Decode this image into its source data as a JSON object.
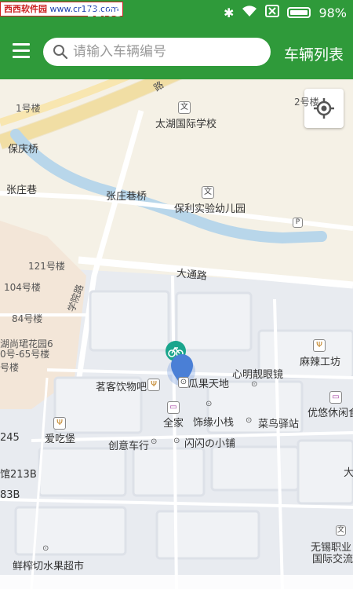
{
  "statusbar": {
    "watermark_a": "西西软件园",
    "watermark_b": "www.cr173.com",
    "time": "11:03",
    "battery_pct": "98%"
  },
  "appbar": {
    "search_placeholder": "请输入车辆编号",
    "vehicle_list_label": "车辆列表"
  },
  "map": {
    "labels": {
      "road_lu": "路",
      "bldg1": "1号楼",
      "school": "太湖国际学校",
      "bldg2": "2号楼",
      "baoqing_bridge": "保庆桥",
      "zhangzhuang_lane": "张庄巷",
      "zhangzhuang_bridge": "张庄巷桥",
      "kindergarten": "保利实验幼儿园",
      "bldg121": "121号楼",
      "bldg104": "104号楼",
      "datong_road": "大通路",
      "xueyuan_road": "学院路",
      "bldg84": "84号楼",
      "huxuan_garden": "湖尚珺花园6",
      "bldg65": "0号-65号楼",
      "bldg_lou": "号楼",
      "malagongfang": "麻辣工坊",
      "xinming_glasses": "心明靓眼镜",
      "guaguo": "瓜果天地",
      "mingke": "茗客饮物吧",
      "youyou": "优悠休闲食",
      "quanjia": "全家",
      "shiyuan": "饰缘小栈",
      "cainiao": "菜鸟驿站",
      "aichibao": "爱吃堡",
      "n245": "245",
      "chuangyi": "创意车行",
      "shanshan": "闪闪の小铺",
      "guan213b": "馆213B",
      "b83": "83B",
      "da": "大",
      "wuxi1": "无锡职业",
      "wuxi2": "国际交流",
      "xianzha": "鲜榨切水果超市"
    }
  },
  "colors": {
    "brand_green": "#2f9a3a",
    "marker_blue": "#4a7fd6",
    "bike_teal": "#1aa58c",
    "river": "#b8d6ea",
    "campus": "#e9ecf1"
  }
}
